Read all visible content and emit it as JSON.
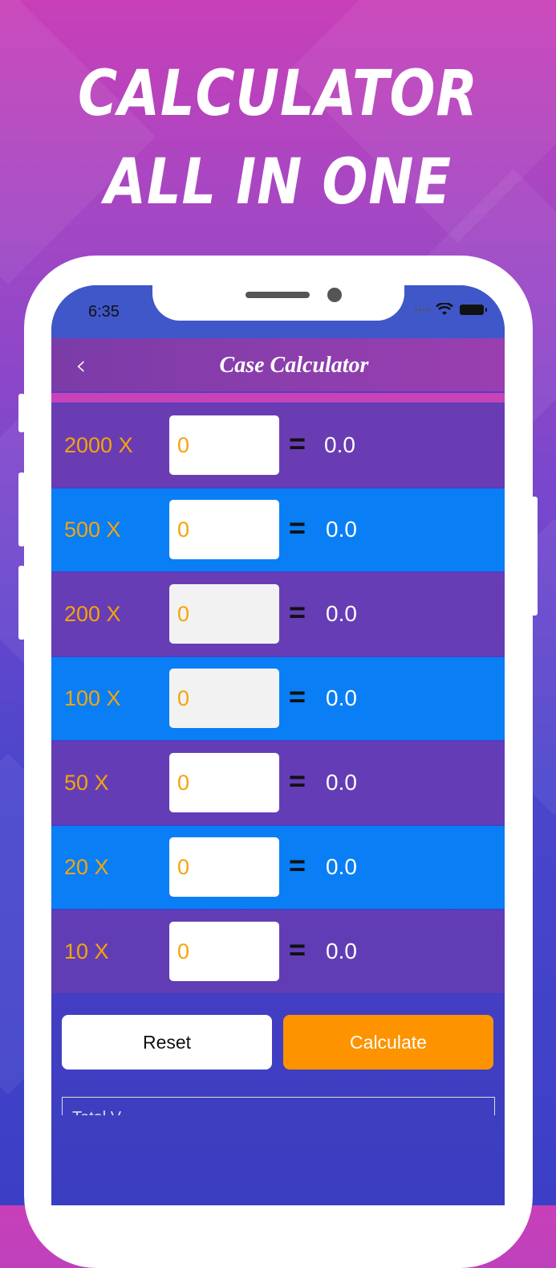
{
  "headline": {
    "line1": "CALCULATOR",
    "line2": "ALL IN ONE"
  },
  "status_bar": {
    "time": "6:35"
  },
  "navbar": {
    "back_icon": "chevron-left-icon",
    "title": "Case Calculator"
  },
  "rows": [
    {
      "multiplier": "2000 X",
      "value": "0",
      "equals": "=",
      "result": "0.0"
    },
    {
      "multiplier": "500 X",
      "value": "0",
      "equals": "=",
      "result": "0.0"
    },
    {
      "multiplier": "200 X",
      "value": "0",
      "equals": "=",
      "result": "0.0"
    },
    {
      "multiplier": "100 X",
      "value": "0",
      "equals": "=",
      "result": "0.0"
    },
    {
      "multiplier": "50 X",
      "value": "0",
      "equals": "=",
      "result": "0.0"
    },
    {
      "multiplier": "20 X",
      "value": "0",
      "equals": "=",
      "result": "0.0"
    },
    {
      "multiplier": "10 X",
      "value": "0",
      "equals": "=",
      "result": "0.0"
    }
  ],
  "actions": {
    "reset_label": "Reset",
    "calculate_label": "Calculate"
  },
  "total": {
    "label": "Total V..."
  },
  "colors": {
    "accent_orange": "#fe9300",
    "row_blue": "#0a7ef5",
    "multiplier_text": "#f5a40a"
  }
}
